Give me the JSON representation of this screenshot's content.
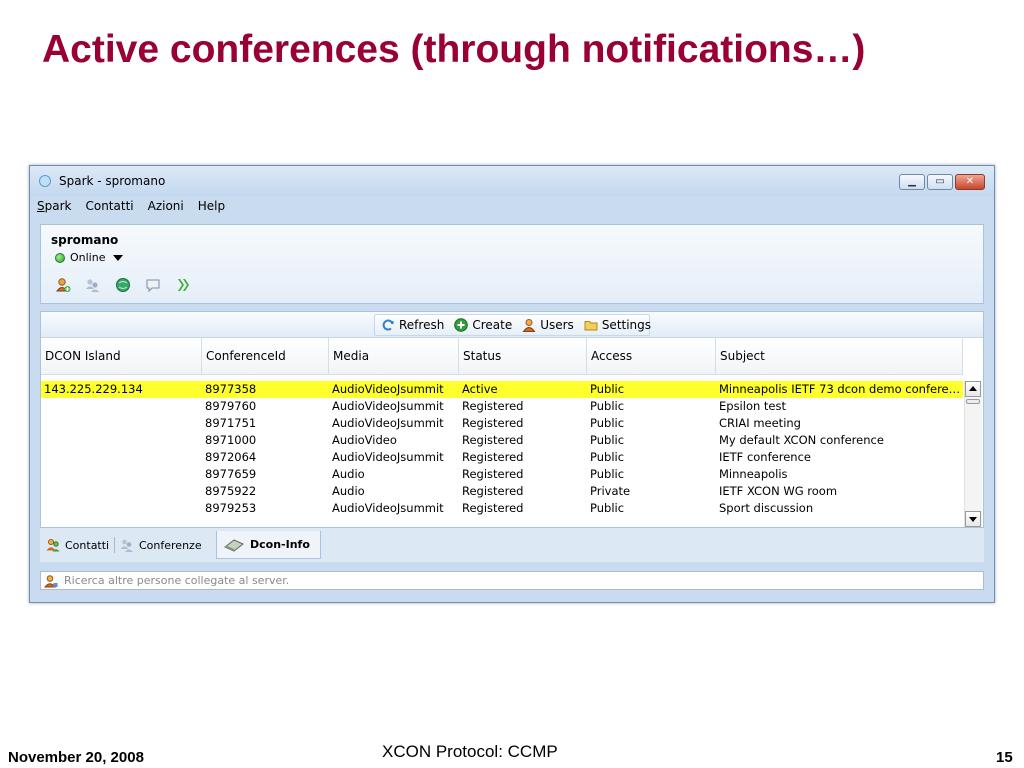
{
  "slide": {
    "title": "Active conferences (through notifications…)",
    "footer_date": "November 20, 2008",
    "footer_center": "XCON Protocol: CCMP",
    "page_number": "15"
  },
  "window": {
    "title": "Spark - spromano",
    "icon": "spark-chat-icon",
    "controls": [
      "minimize-icon",
      "maximize-icon",
      "close-icon"
    ]
  },
  "menu": {
    "items": [
      "Spark",
      "Contatti",
      "Azioni",
      "Help"
    ]
  },
  "profile": {
    "username": "spromano",
    "status": "Online",
    "status_color": "#2f9e2a",
    "tools": [
      "add-contact-icon",
      "join-conference-icon",
      "status-globe-icon",
      "send-message-icon",
      "phone-icon"
    ]
  },
  "toolbar": {
    "refresh": "Refresh",
    "create": "Create",
    "users": "Users",
    "settings": "Settings"
  },
  "table": {
    "columns": [
      "DCON Island",
      "ConferenceId",
      "Media",
      "Status",
      "Access",
      "Subject"
    ],
    "rows": [
      [
        "143.225.229.134",
        "8977358",
        "AudioVideoJsummit",
        "Active",
        "Public",
        "Minneapolis IETF 73 dcon demo confere…"
      ],
      [
        "",
        "8979760",
        "AudioVideoJsummit",
        "Registered",
        "Public",
        "Epsilon test"
      ],
      [
        "",
        "8971751",
        "AudioVideoJsummit",
        "Registered",
        "Public",
        "CRIAI meeting"
      ],
      [
        "",
        "8971000",
        "AudioVideo",
        "Registered",
        "Public",
        "My default XCON conference"
      ],
      [
        "",
        "8972064",
        "AudioVideoJsummit",
        "Registered",
        "Public",
        "IETF conference"
      ],
      [
        "",
        "8977659",
        "Audio",
        "Registered",
        "Public",
        "Minneapolis"
      ],
      [
        "",
        "8975922",
        "Audio",
        "Registered",
        "Private",
        "IETF XCON WG room"
      ],
      [
        "",
        "8979253",
        "AudioVideoJsummit",
        "Registered",
        "Public",
        "Sport discussion"
      ]
    ],
    "selected_row_color": "#ffff2e"
  },
  "tabs": {
    "contatti": "Contatti",
    "conferenze": "Conferenze",
    "dcon": "Dcon-Info"
  },
  "search": {
    "placeholder": "Ricerca altre persone collegate al server."
  },
  "colors": {
    "title": "#990033",
    "window_frame": "#c9dbee"
  }
}
